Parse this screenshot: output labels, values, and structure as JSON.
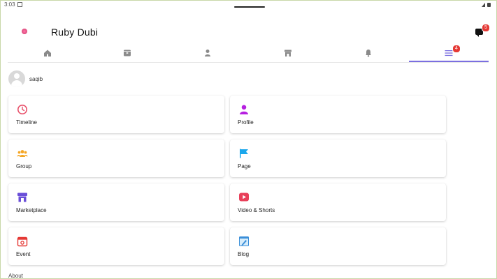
{
  "status_bar": {
    "time": "3:03"
  },
  "app": {
    "title": "Ruby Dubi",
    "messages_badge": "5"
  },
  "tabs": [
    {
      "id": "home",
      "icon": "home-icon"
    },
    {
      "id": "watch",
      "icon": "video-icon"
    },
    {
      "id": "profile",
      "icon": "person-icon"
    },
    {
      "id": "marketplace",
      "icon": "store-icon"
    },
    {
      "id": "notifications",
      "icon": "bell-icon"
    },
    {
      "id": "menu",
      "icon": "menu-icon",
      "badge": "4",
      "active": true
    }
  ],
  "user": {
    "name": "saqib"
  },
  "menu": {
    "items": [
      {
        "label": "Timeline",
        "icon": "clock-icon",
        "color": "#e8506a"
      },
      {
        "label": "Profile",
        "icon": "person-icon",
        "color": "#b620e0"
      },
      {
        "label": "Group",
        "icon": "group-icon",
        "color": "#f5a623"
      },
      {
        "label": "Page",
        "icon": "flag-icon",
        "color": "#1aa7ec"
      },
      {
        "label": "Marketplace",
        "icon": "store-icon",
        "color": "#6a4fd8"
      },
      {
        "label": "Video & Shorts",
        "icon": "play-icon",
        "color": "#e8405a"
      },
      {
        "label": "Event",
        "icon": "calendar-icon",
        "color": "#e53935"
      },
      {
        "label": "Blog",
        "icon": "blog-icon",
        "color": "#3b8fd9"
      }
    ],
    "about_label": "About"
  },
  "colors": {
    "accent": "#7b6fe0",
    "badge": "#e53935"
  }
}
